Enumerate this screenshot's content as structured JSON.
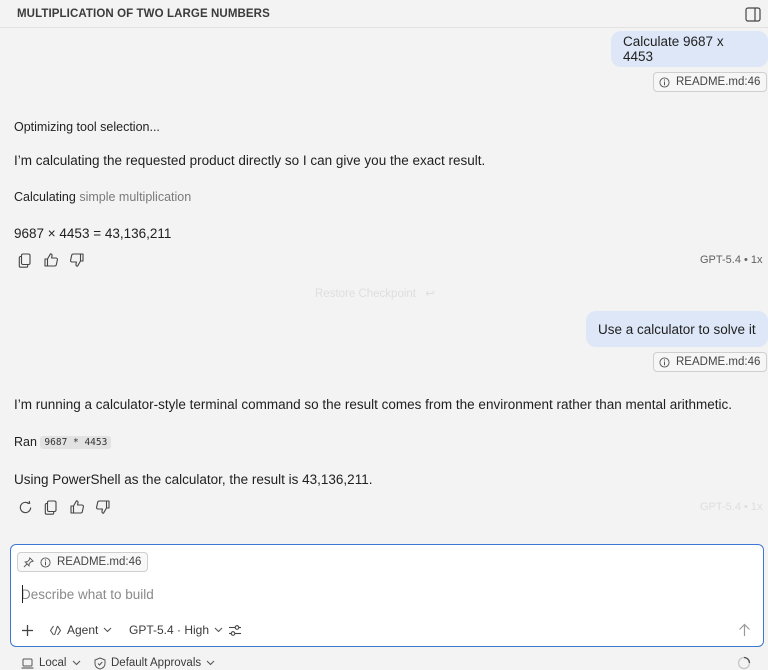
{
  "header": {
    "title": "MULTIPLICATION OF TWO LARGE NUMBERS"
  },
  "conversation": {
    "turn1": {
      "user_message": "Calculate 9687 x 4453",
      "reference": "README.md:46",
      "status": "Optimizing tool selection...",
      "intro": "I’m calculating the requested product directly so I can give you the exact result.",
      "step_label": "Calculating",
      "step_detail": "simple multiplication",
      "result": "9687 × 4453 = 43,136,211",
      "model_meta": "GPT-5.4 • 1x"
    },
    "restore_checkpoint": "Restore Checkpoint",
    "turn2": {
      "user_message": "Use a calculator to solve it",
      "reference": "README.md:46",
      "intro": "I’m running a calculator-style terminal command so the result comes from the environment rather than mental arithmetic.",
      "ran_label": "Ran",
      "command": "9687 * 4453",
      "result": "Using PowerShell as the calculator, the result is 43,136,211.",
      "model_meta": "GPT-5.4 • 1x"
    }
  },
  "composer": {
    "reference": "README.md:46",
    "placeholder": "Describe what to build",
    "value": "",
    "mode": "Agent",
    "model": "GPT-5.4 · High"
  },
  "footer": {
    "location": "Local",
    "approvals": "Default Approvals"
  },
  "colors": {
    "accent": "#3b78d4",
    "user_bubble": "#dde7f7",
    "background": "#f3f3f3"
  },
  "icons": [
    "panel-toggle-icon",
    "info-icon",
    "copy-icon",
    "thumbs-up-icon",
    "thumbs-down-icon",
    "retry-icon",
    "pin-icon",
    "plus-icon",
    "agent-icon",
    "chevron-down-icon",
    "settings-sliders-icon",
    "send-arrow-icon",
    "laptop-icon",
    "shield-icon",
    "spinner-icon"
  ]
}
